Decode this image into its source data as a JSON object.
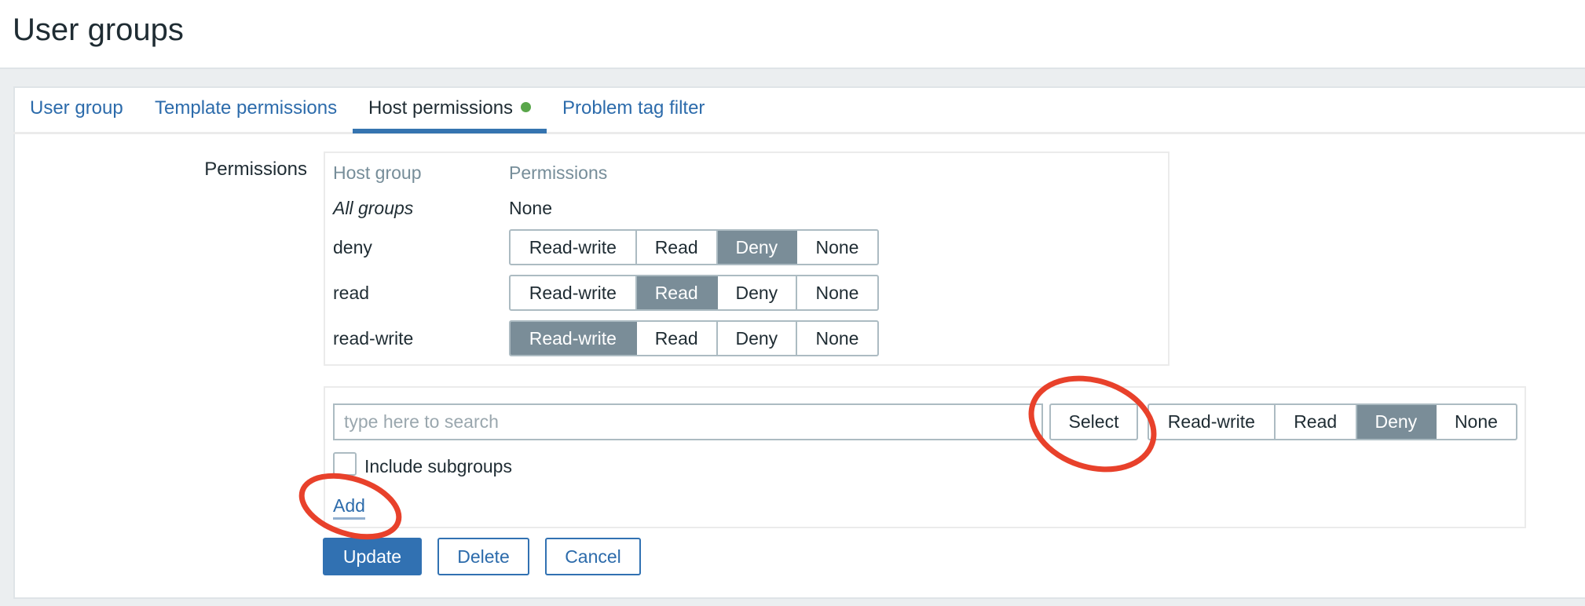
{
  "header": {
    "title": "User groups"
  },
  "tabs": [
    {
      "label": "User group",
      "active": false
    },
    {
      "label": "Template permissions",
      "active": false
    },
    {
      "label": "Host permissions",
      "active": true,
      "indicator": "green-dot"
    },
    {
      "label": "Problem tag filter",
      "active": false
    }
  ],
  "form": {
    "permissions_label": "Permissions",
    "table": {
      "columns": [
        "Host group",
        "Permissions"
      ],
      "all_groups": {
        "name": "All groups",
        "value": "None"
      },
      "options": [
        "Read-write",
        "Read",
        "Deny",
        "None"
      ],
      "rows": [
        {
          "name": "deny",
          "selected": "Deny"
        },
        {
          "name": "read",
          "selected": "Read"
        },
        {
          "name": "read-write",
          "selected": "Read-write"
        }
      ]
    },
    "add": {
      "search_placeholder": "type here to search",
      "search_value": "",
      "select_label": "Select",
      "options": [
        "Read-write",
        "Read",
        "Deny",
        "None"
      ],
      "selected": "Deny",
      "include_subgroups_label": "Include subgroups",
      "include_subgroups_checked": false,
      "add_link": "Add"
    },
    "buttons": {
      "update": "Update",
      "delete": "Delete",
      "cancel": "Cancel"
    }
  },
  "annotations": {
    "color": "#e8412b",
    "highlighted": [
      "Select",
      "Add"
    ]
  }
}
